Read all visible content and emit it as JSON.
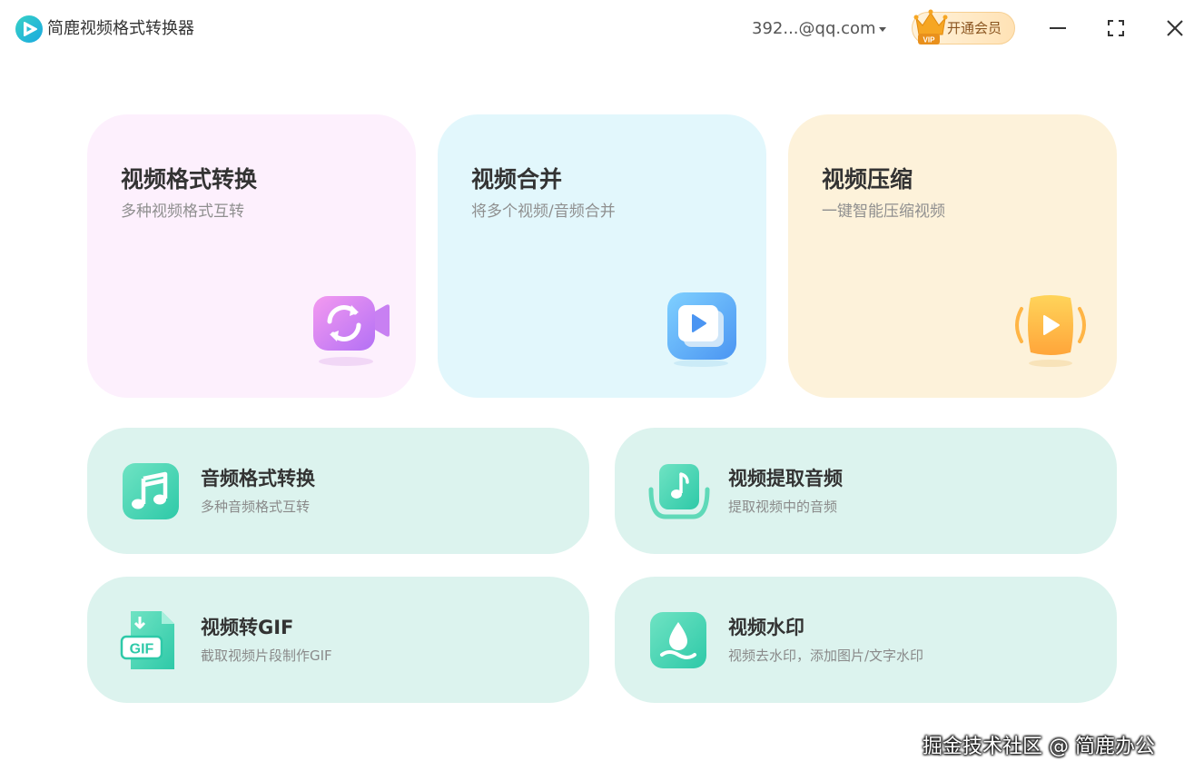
{
  "app": {
    "title": "简鹿视频格式转换器",
    "account": "392...@qq.com",
    "vip_badge": "VIP",
    "vip_button_label": "开通会员",
    "colors": {
      "brand": "#2dbfd0",
      "vip": "#f6a623"
    }
  },
  "window_controls": {
    "icons": [
      "minimize-icon",
      "maximize-icon",
      "close-icon"
    ]
  },
  "features_main": [
    {
      "title": "视频格式转换",
      "subtitle": "多种视频格式互转",
      "icon": "video-convert-icon",
      "color": "#fdf0fd"
    },
    {
      "title": "视频合并",
      "subtitle": "将多个视频/音频合并",
      "icon": "video-merge-icon",
      "color": "#e2f7fc"
    },
    {
      "title": "视频压缩",
      "subtitle": "一键智能压缩视频",
      "icon": "video-compress-icon",
      "color": "#fdf2da"
    }
  ],
  "features_tools": [
    {
      "title": "音频格式转换",
      "subtitle": "多种音频格式互转",
      "icon": "music-note-icon"
    },
    {
      "title": "视频提取音频",
      "subtitle": "提取视频中的音频",
      "icon": "audio-extract-icon"
    },
    {
      "title": "视频转GIF",
      "subtitle": "截取视频片段制作GIF",
      "icon": "gif-file-icon",
      "icon_text": "GIF"
    },
    {
      "title": "视频水印",
      "subtitle": "视频去水印，添加图片/文字水印",
      "icon": "watermark-drop-icon"
    }
  ],
  "footer": {
    "watermark": "掘金技术社区 @ 简鹿办公"
  }
}
